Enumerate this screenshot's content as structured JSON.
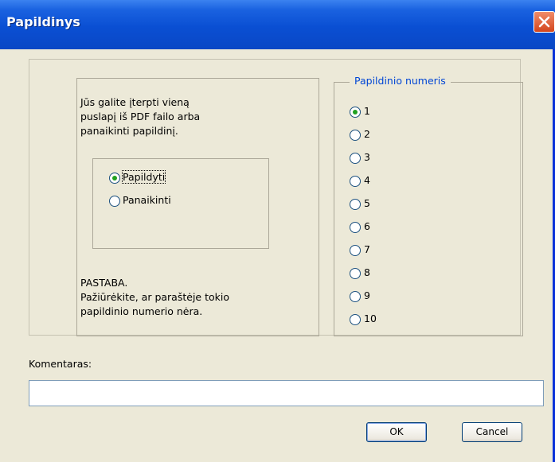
{
  "window": {
    "title": "Papildinys"
  },
  "instructions": [
    "Jūs galite įterpti vieną",
    "puslapį iš PDF failo arba",
    "panaikinti papildinį."
  ],
  "action_options": [
    {
      "label": "Papildyti",
      "checked": true
    },
    {
      "label": "Panaikinti",
      "checked": false
    }
  ],
  "note": [
    "PASTABA.",
    "Pažiūrėkite, ar paraštėje tokio",
    "papildinio numerio nėra."
  ],
  "number_group": {
    "legend": "Papildinio numeris",
    "options": [
      "1",
      "2",
      "3",
      "4",
      "5",
      "6",
      "7",
      "8",
      "9",
      "10"
    ],
    "selected": "1"
  },
  "comment": {
    "label": "Komentaras:",
    "value": ""
  },
  "buttons": {
    "ok": "OK",
    "cancel": "Cancel"
  },
  "colors": {
    "title_bar": "#0a4fd3",
    "legend": "#0046d5",
    "radio_dot": "#21a121",
    "dialog_bg": "#ece9d8"
  }
}
